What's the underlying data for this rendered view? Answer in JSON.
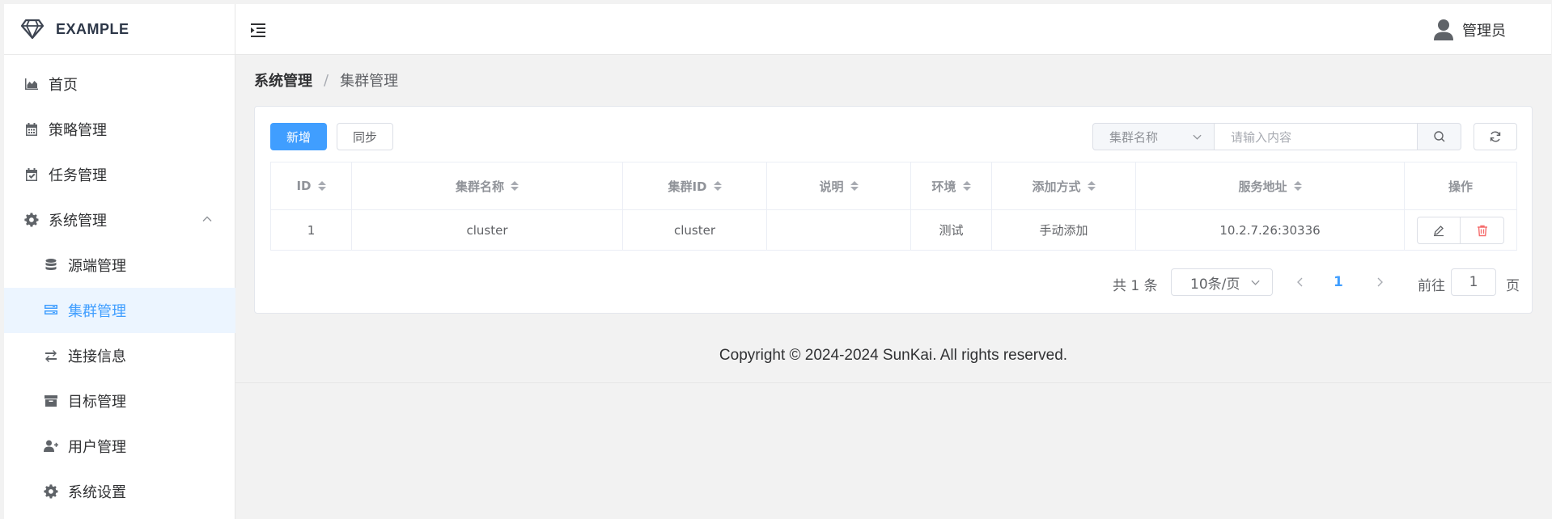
{
  "brand": {
    "name": "EXAMPLE"
  },
  "header": {
    "user_name": "管理员"
  },
  "sidebar": {
    "items": [
      {
        "label": "首页",
        "icon": "area-chart-icon"
      },
      {
        "label": "策略管理",
        "icon": "calendar-icon"
      },
      {
        "label": "任务管理",
        "icon": "calendar-check-icon"
      },
      {
        "label": "系统管理",
        "icon": "gear-icon",
        "expanded": true
      }
    ],
    "subitems": [
      {
        "label": "源端管理",
        "icon": "database-icon"
      },
      {
        "label": "集群管理",
        "icon": "server-icon",
        "active": true
      },
      {
        "label": "连接信息",
        "icon": "exchange-icon"
      },
      {
        "label": "目标管理",
        "icon": "archive-icon"
      },
      {
        "label": "用户管理",
        "icon": "user-plus-icon"
      },
      {
        "label": "系统设置",
        "icon": "gear-icon"
      }
    ]
  },
  "breadcrumb": {
    "level1": "系统管理",
    "separator": "/",
    "level2": "集群管理"
  },
  "toolbar": {
    "add_label": "新增",
    "sync_label": "同步",
    "search_field": "集群名称",
    "search_placeholder": "请输入内容"
  },
  "table": {
    "columns": [
      "ID",
      "集群名称",
      "集群ID",
      "说明",
      "环境",
      "添加方式",
      "服务地址",
      "操作"
    ],
    "rows": [
      {
        "id": "1",
        "name": "cluster",
        "cluster_id": "cluster",
        "desc": "",
        "env": "测试",
        "add_method": "手动添加",
        "address": "10.2.7.26:30336"
      }
    ]
  },
  "pagination": {
    "total_text": "共 1 条",
    "page_size": "10条/页",
    "current_page": "1",
    "goto_label": "前往",
    "goto_value": "1",
    "page_suffix": "页"
  },
  "footer": {
    "copyright": "Copyright © 2024-2024 SunKai. All rights reserved."
  },
  "colors": {
    "primary": "#409eff",
    "danger": "#f56c6c",
    "active_bg": "#ecf5ff"
  }
}
